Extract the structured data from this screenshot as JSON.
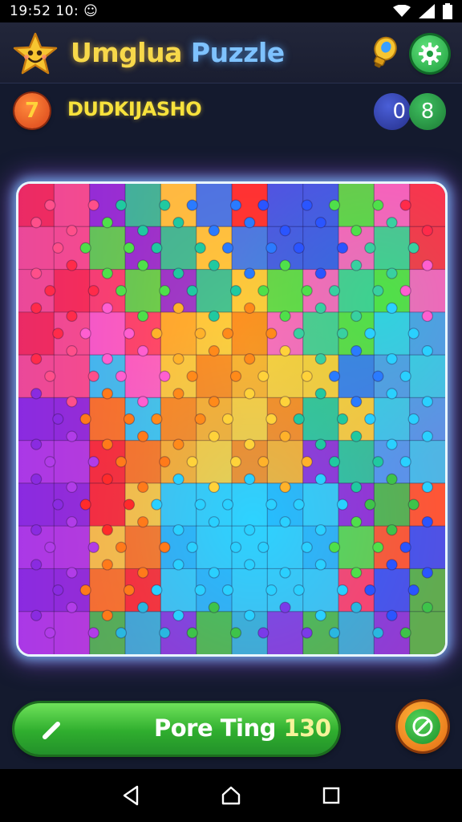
{
  "status_bar": {
    "time": "19:52 10: ☺"
  },
  "header": {
    "title_part1": "Umglua",
    "title_part2": "Puzzle"
  },
  "level": {
    "number": "7",
    "name": "DUDKIJASHO"
  },
  "counter": {
    "left": "0",
    "right": "8"
  },
  "action": {
    "label_text": "Pore Ting",
    "label_number": "130"
  },
  "colors": {
    "accent_green": "#2fae2e",
    "title_yellow": "#f7d84a",
    "title_blue": "#7ec2ff",
    "frame_glow": "#e8f6ff"
  },
  "icons": [
    "star-mascot-icon",
    "hint-bulb-icon",
    "gear-icon",
    "pencil-icon",
    "wand-icon",
    "back-icon",
    "home-icon",
    "recents-icon",
    "wifi-icon",
    "signal-icon",
    "battery-icon"
  ],
  "board": {
    "grid_cols": 12,
    "grid_rows": 11
  }
}
